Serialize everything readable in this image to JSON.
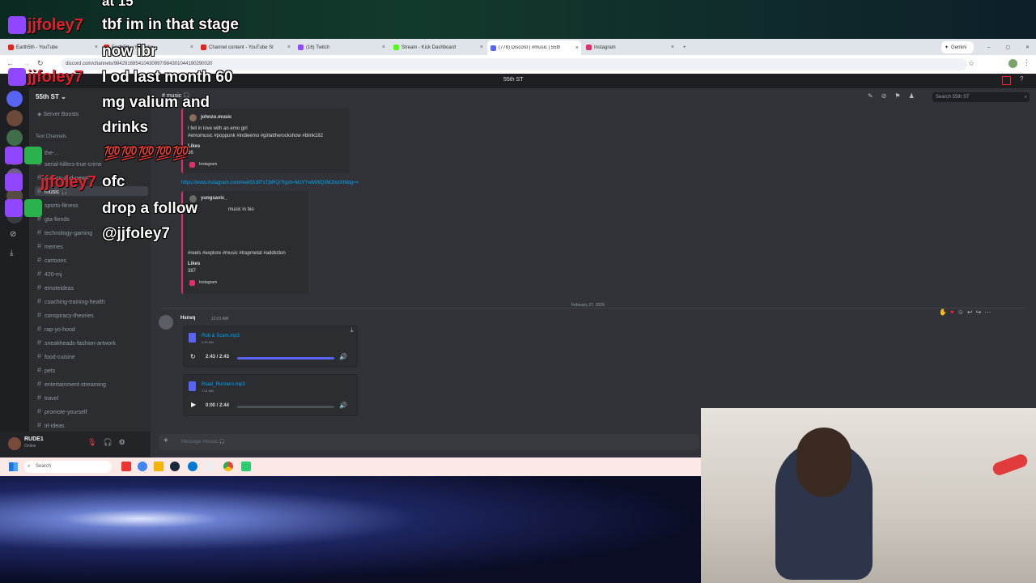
{
  "overlay": {
    "top_partial": "at 15",
    "user": "jjfoley7",
    "messages": [
      "tbf im in that stage",
      "now ibr",
      "I od last month 60",
      "mg valium and",
      "drinks",
      "ofc",
      "drop a follow",
      "@jjfoley7"
    ],
    "emotes": "💯💯💯💯💯"
  },
  "browser": {
    "tabs": [
      "Earth5th - YouTube",
      "Channel content - YouTube St",
      "(16) Twitch",
      "Stream - Kick Dashboard",
      "(778) Discord | #music | 55th",
      "Instagram"
    ],
    "url": "discord.com/channels/984291685410430997/984301044190290020",
    "profile_label": "Gemini"
  },
  "discord": {
    "window_title": "55th ST",
    "server_name": "55th ST",
    "server_boosts": "Server Boosts",
    "section": "Text Channels",
    "channels": [
      "the-...",
      "serial-killers-true-crime",
      "politics-and-news",
      "music 🎧",
      "sports-fitness",
      "gta-fiends",
      "technology-gaming",
      "memes",
      "cartoons",
      "420-mj",
      "emoteideas",
      "coaching-training-health",
      "conspiracy-theories",
      "rap-yo-hood",
      "sneakheads-fashion-artwork",
      "food-cuisine",
      "pets",
      "entertainment-streaming",
      "travel",
      "promote-yourself",
      "irl-ideas"
    ],
    "header_channel": "music 🎧",
    "search_placeholder": "Search 55th ST",
    "embed1": {
      "author": "johnzo.music",
      "text": "I fell in love with an emo girl",
      "tags": "#emomusic #poppunk #indieemo #girlattherockshow #blink182",
      "likes_label": "Likes",
      "likes": "66",
      "source": "Instagram"
    },
    "link": "https://www.instagram.com/reel/DU8TxTjbRQ/?igsh=MzVYwMWQ3M2txdXNibg==",
    "embed2": {
      "author": "yungsavic_",
      "bio": "music in bio",
      "tags": "#reels #explore #music #trapmetal #addiction",
      "likes_label": "Likes",
      "likes": "387",
      "source": "Instagram"
    },
    "date_divider": "February 27, 2026",
    "message": {
      "author": "Hxnvq",
      "time": "12:01 AM"
    },
    "audio1": {
      "name": "Rob & Scam.mp3",
      "size": "4.29 MB",
      "time": "2:43 / 2:43",
      "progress": 1.0
    },
    "audio2": {
      "name": "Road_Runners.mp3",
      "size": "7.01 MB",
      "time": "0:00 / 2:44",
      "progress": 0.0
    },
    "composer_placeholder": "Message #music 🎧",
    "user": {
      "name": "RUDE1",
      "status": "Online"
    }
  },
  "taskbar": {
    "search": "Search"
  },
  "colors": {
    "discord_bg": "#313338",
    "sidebar": "#2b2d31",
    "accent": "#5865f2",
    "chat_name": "#e0202a"
  }
}
